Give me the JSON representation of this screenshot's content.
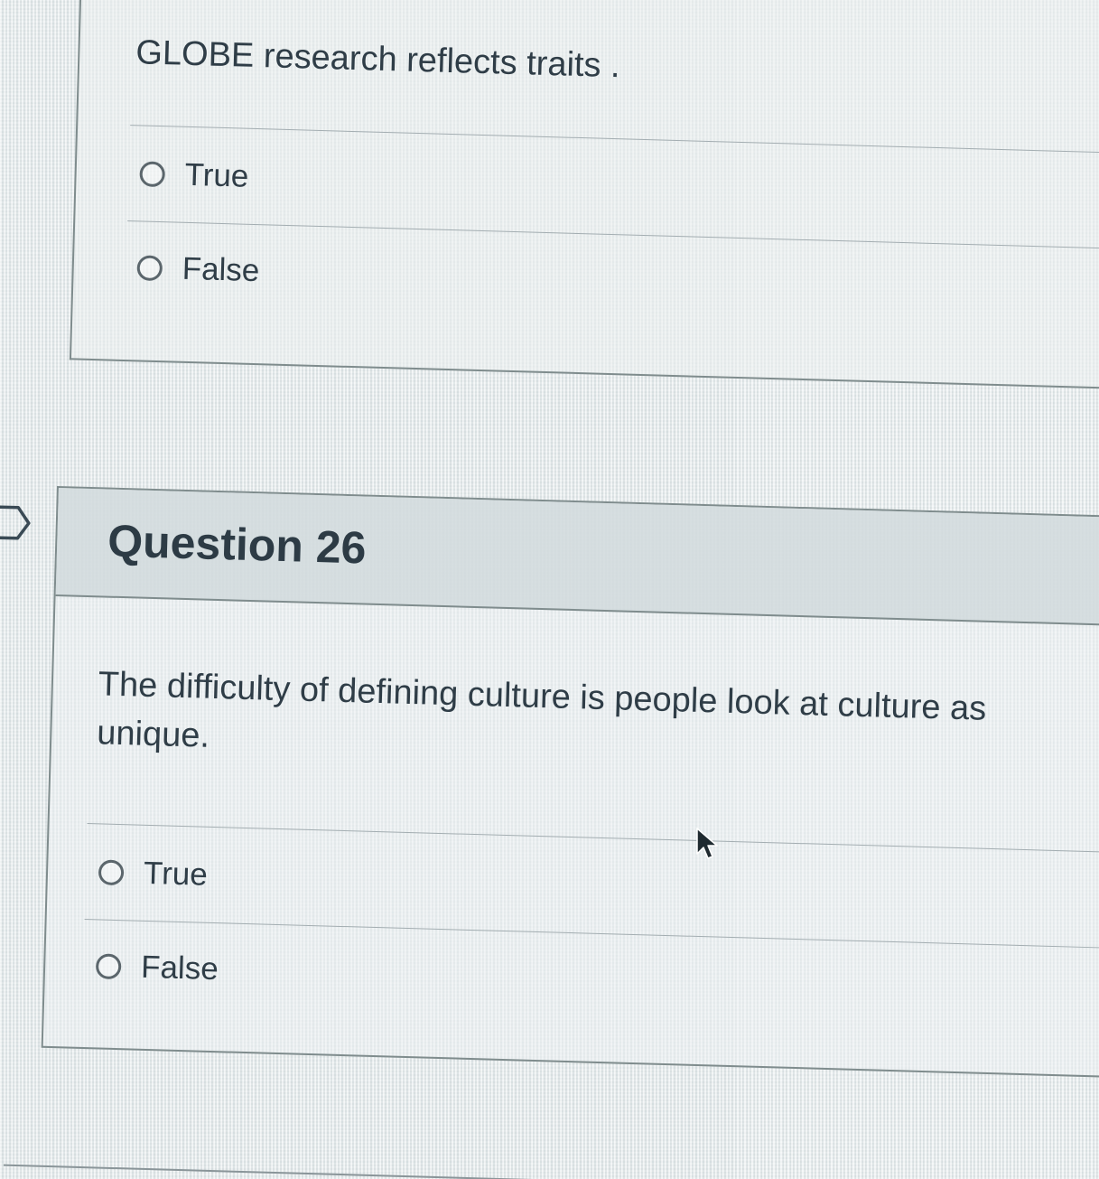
{
  "question_25": {
    "text": "GLOBE research reflects traits .",
    "options": [
      {
        "label": "True",
        "selected": false
      },
      {
        "label": "False",
        "selected": false
      }
    ]
  },
  "question_26": {
    "title": "Question 26",
    "text_line_1": "The difficulty of defining culture is people look at culture as",
    "text_line_2": "unique.",
    "options": [
      {
        "label": "True",
        "selected": false
      },
      {
        "label": "False",
        "selected": false
      }
    ]
  },
  "icons": {
    "flag": "bookmark-flag-icon",
    "cursor": "mouse-pointer-icon",
    "radio": "radio-unchecked-icon"
  },
  "colors": {
    "text": "#2d3b45",
    "border": "#7f8c8d",
    "header_bg": "#ced7da"
  }
}
